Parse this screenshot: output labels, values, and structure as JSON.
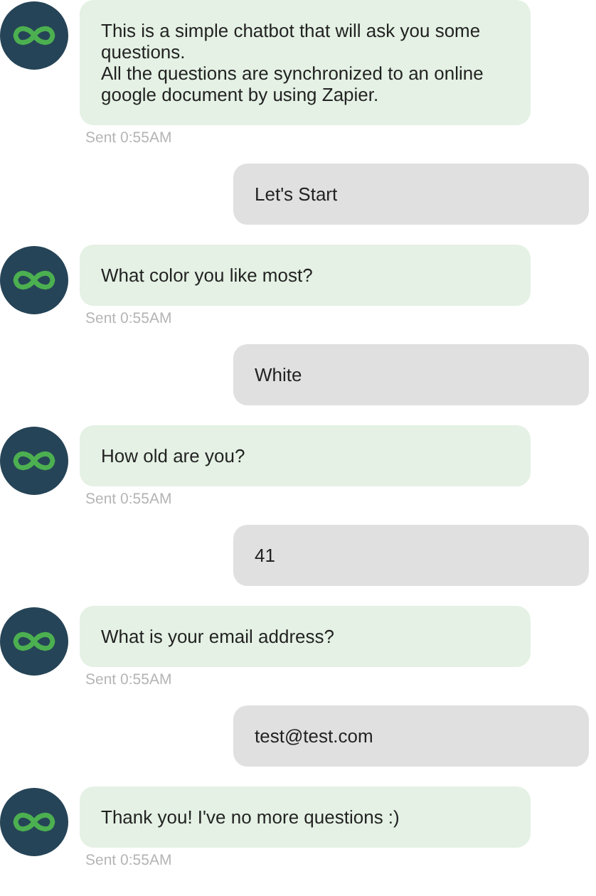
{
  "messages": [
    {
      "kind": "bot",
      "lines": [
        "This is a simple chatbot that will ask you some questions.",
        "All the questions are synchronized to an online google document by using Zapier."
      ],
      "time": "Sent 0:55AM"
    },
    {
      "kind": "user",
      "lines": [
        "Let's Start"
      ]
    },
    {
      "kind": "bot",
      "lines": [
        "What color you like most?"
      ],
      "time": "Sent 0:55AM"
    },
    {
      "kind": "user",
      "lines": [
        "White"
      ]
    },
    {
      "kind": "bot",
      "lines": [
        "How old are you?"
      ],
      "time": "Sent 0:55AM"
    },
    {
      "kind": "user",
      "lines": [
        "41"
      ]
    },
    {
      "kind": "bot",
      "lines": [
        "What is your email address?"
      ],
      "time": "Sent 0:55AM"
    },
    {
      "kind": "user",
      "lines": [
        "test@test.com"
      ]
    },
    {
      "kind": "bot",
      "lines": [
        "Thank you! I've no more questions :)"
      ],
      "time": "Sent 0:55AM"
    }
  ]
}
